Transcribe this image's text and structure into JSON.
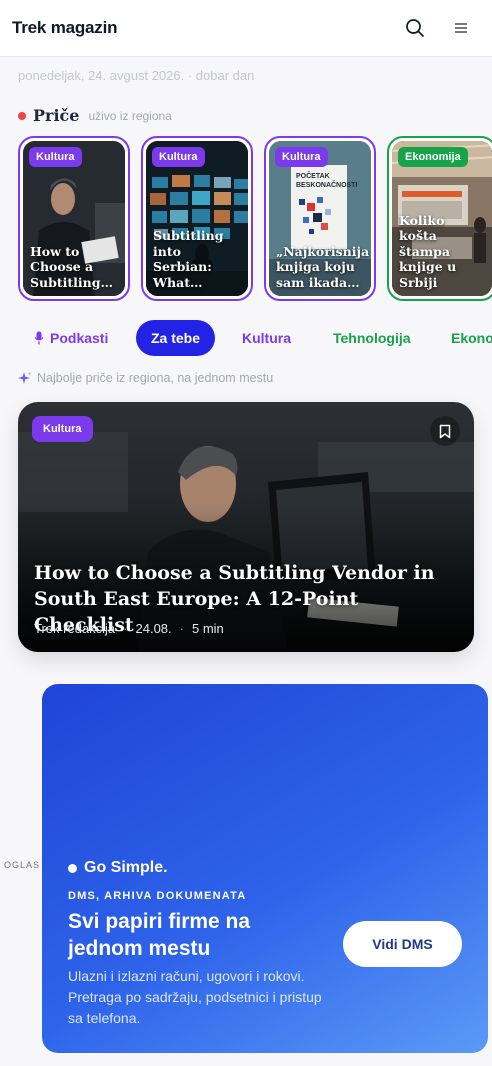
{
  "header": {
    "brand": "Trek magazin",
    "search_icon": "search-icon",
    "menu_icon": "menu-icon"
  },
  "greeting": "ponedeljak, 24. avgust 2026. · dobar dan",
  "stories": {
    "title": "Priče",
    "subtitle": "uživo iz regiona",
    "items": [
      {
        "category": "Kultura",
        "title": "How to Choose a Subtitling…",
        "accent": "#7c3aed"
      },
      {
        "category": "Kultura",
        "title": "Subtitling into Serbian: What…",
        "accent": "#7c3aed"
      },
      {
        "category": "Kultura",
        "title": "„Najkorisnija knjiga koju sam ikada…",
        "accent": "#7c3aed"
      },
      {
        "category": "Ekonomija",
        "title": "Koliko košta štampa knjige u Srbiji",
        "accent": "#16a34a"
      }
    ],
    "book_cover_text": "POČETAK BESKONAČNOSTI"
  },
  "tabs": [
    {
      "label": "Podkasti",
      "icon": "microphone-icon"
    },
    {
      "label": "Za tebe",
      "active": true
    },
    {
      "label": "Kultura"
    },
    {
      "label": "Tehnologija"
    },
    {
      "label": "Ekono"
    }
  ],
  "tagline": "Najbolje priče iz regiona, na jednom mestu",
  "hero": {
    "category": "Kultura",
    "title": "How to Choose a Subtitling Vendor in South East Europe: A 12-Point Checklist",
    "author": "Trek redakcija",
    "date": "24.08.",
    "read_time": "5 min"
  },
  "ad": {
    "label": "OGLAS",
    "brand": "Go Simple.",
    "kicker": "DMS, ARHIVA DOKUMENATA",
    "headline": "Svi papiri firme na jednom mestu",
    "body": "Ulazni i izlazni računi, ugovori i rokovi. Pretraga po sadržaju, podsetnici i pristup sa telefona.",
    "cta": "Vidi DMS"
  },
  "colors": {
    "purple": "#7c3aed",
    "green": "#16a34a",
    "active_tab": "#2323e6",
    "ad_blue": "#2e63ea"
  }
}
